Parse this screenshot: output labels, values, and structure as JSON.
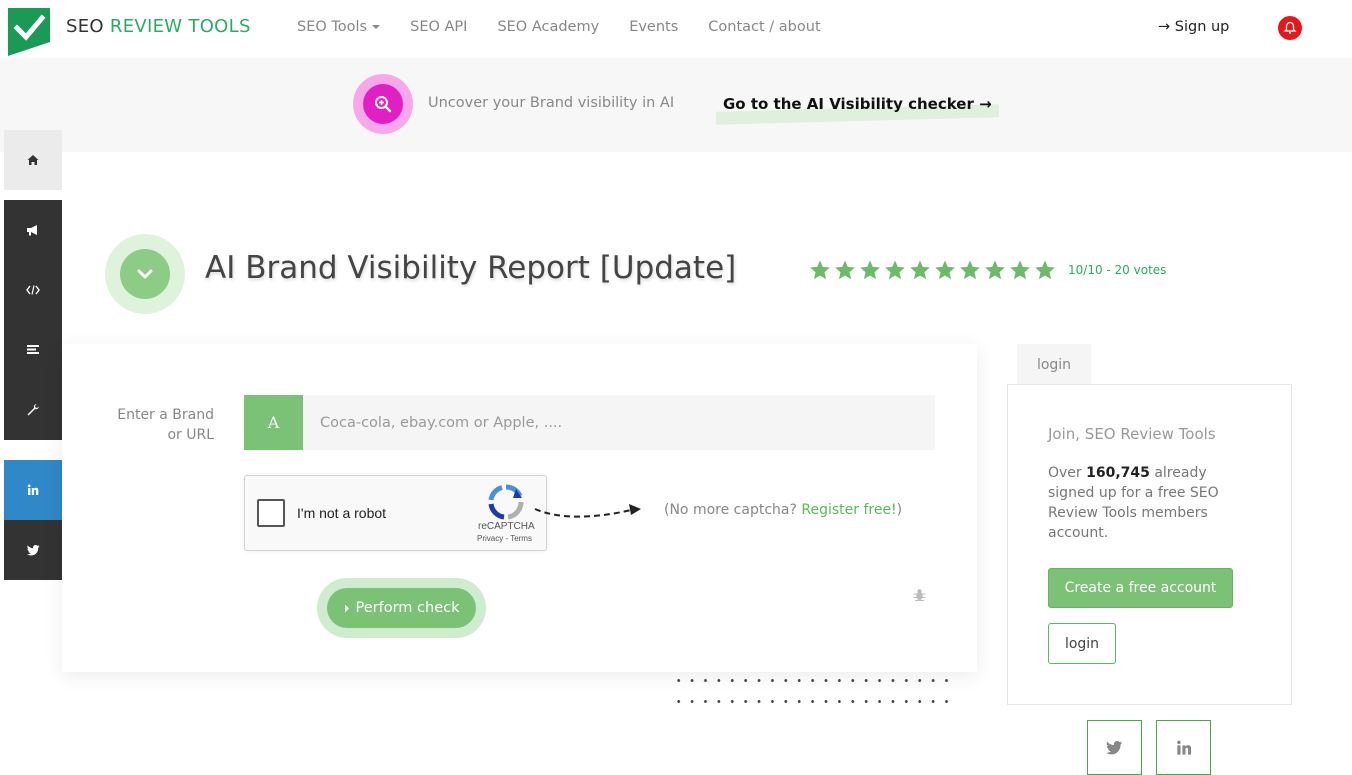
{
  "header": {
    "logo_text_main": "SEO",
    "logo_text_accent": "REVIEW TOOLS",
    "nav": [
      {
        "label": "SEO Tools",
        "has_dropdown": true
      },
      {
        "label": "SEO API"
      },
      {
        "label": "SEO Academy"
      },
      {
        "label": "Events"
      },
      {
        "label": "Contact / about"
      }
    ],
    "signup_label": "→ Sign up",
    "bell_icon": "bell-icon",
    "brand_color": "#27ae60",
    "bell_color": "#e8161b"
  },
  "promo": {
    "icon": "search-zoom-icon",
    "text": "Uncover your Brand visibility in AI",
    "link": "Go to the AI Visibility checker →",
    "accent": "#e020c4"
  },
  "sidebar": {
    "items": [
      {
        "icon": "home-icon"
      },
      {
        "icon": "megaphone-icon"
      },
      {
        "icon": "code-icon"
      },
      {
        "icon": "list-icon"
      },
      {
        "icon": "wrench-icon"
      },
      {
        "icon": "linkedin-icon",
        "color": "#2f88c8"
      },
      {
        "icon": "twitter-icon"
      }
    ]
  },
  "title": {
    "icon": "chevron-down-icon",
    "text": "AI Brand Visibility Report [Update]",
    "stars_filled": 10,
    "stars_total": 10,
    "rating": "10/10 - 20 votes"
  },
  "form": {
    "label": "Enter a Brand or URL",
    "badge": "A",
    "input_value": "",
    "input_placeholder": "Coca-cola, ebay.com or Apple, ....",
    "captcha_label": "I'm not a robot",
    "captcha_brand": "reCAPTCHA",
    "captcha_terms": "Privacy - Terms",
    "captcha_note_prefix": "(No more captcha? ",
    "captcha_note_link": "Register free!",
    "captcha_note_suffix": ")",
    "submit_label": "Perform check",
    "accent": "#7cc276"
  },
  "login_panel": {
    "tab_label": "login",
    "title": "Join, SEO Review Tools",
    "text_prefix": "Over ",
    "count": "160,745",
    "text_suffix": " already signed up for a free SEO Review Tools members account.",
    "create_label": "Create a free account",
    "login_label": "login",
    "share": [
      {
        "icon": "twitter-icon"
      },
      {
        "icon": "linkedin-icon"
      }
    ]
  }
}
